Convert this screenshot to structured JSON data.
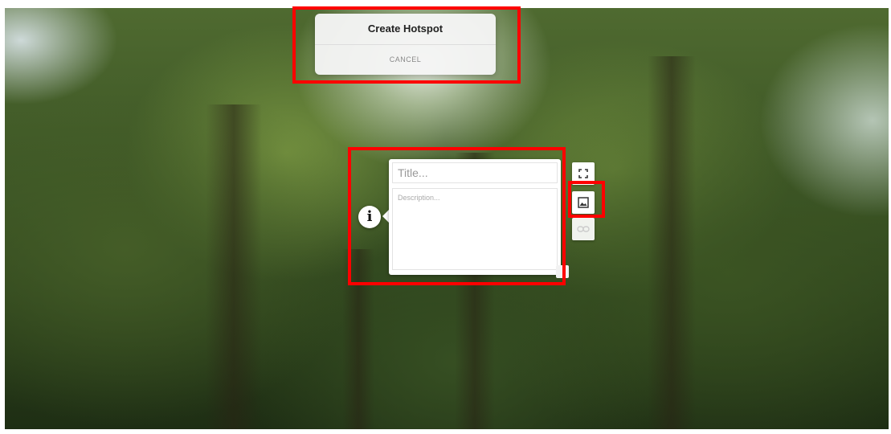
{
  "modal": {
    "title": "Create Hotspot",
    "cancel_label": "CANCEL"
  },
  "hotspot": {
    "icon": "info-icon",
    "icon_glyph": "i",
    "title_placeholder": "Title...",
    "description_placeholder": "Description...",
    "title_value": "",
    "description_value": ""
  },
  "side_toolbar": {
    "buttons": [
      {
        "icon": "fullscreen-icon",
        "enabled": true
      },
      {
        "icon": "image-icon",
        "enabled": true
      },
      {
        "icon": "link-icon",
        "enabled": false
      }
    ]
  },
  "colors": {
    "highlight": "#ff0000",
    "panel": "#ffffff",
    "disabled_icon": "#cccccc"
  }
}
